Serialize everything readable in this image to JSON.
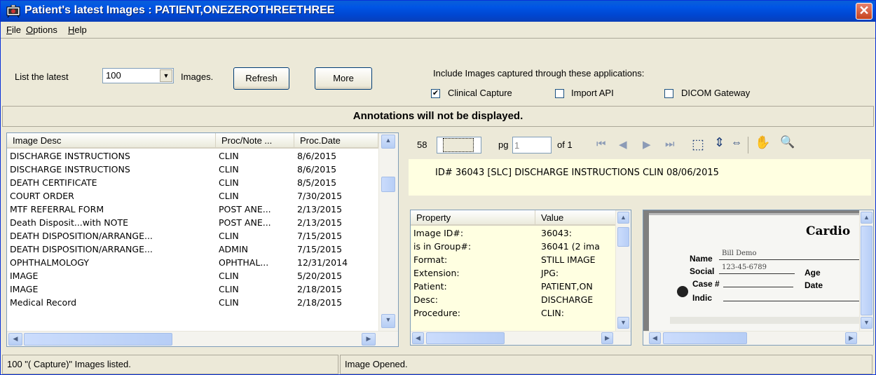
{
  "window": {
    "title": "Patient's latest Images : PATIENT,ONEZEROTHREETHREE",
    "close_symbol": "✕"
  },
  "menu": [
    {
      "label": "File",
      "key": "F"
    },
    {
      "label": "Options",
      "key": "O"
    },
    {
      "label": "Help",
      "key": "H"
    }
  ],
  "toolbar": {
    "list_prefix": "List the latest",
    "count_value": "100",
    "list_suffix": "Images.",
    "refresh_label": "Refresh",
    "more_label": "More",
    "include_label": "Include Images captured through these applications:",
    "sources": [
      {
        "label": "Clinical Capture",
        "checked": true
      },
      {
        "label": "Import API",
        "checked": false
      },
      {
        "label": "DICOM Gateway",
        "checked": false
      }
    ]
  },
  "banner": "Annotations will not be displayed.",
  "image_list": {
    "columns": [
      "Image Desc",
      "Proc/Note ...",
      "Proc.Date"
    ],
    "rows": [
      [
        "DISCHARGE INSTRUCTIONS",
        "CLIN",
        "8/6/2015"
      ],
      [
        "DISCHARGE INSTRUCTIONS",
        "CLIN",
        "8/6/2015"
      ],
      [
        "DEATH CERTIFICATE",
        "CLIN",
        "8/5/2015"
      ],
      [
        "COURT ORDER",
        "CLIN",
        "7/30/2015"
      ],
      [
        "MTF REFERRAL FORM",
        "POST ANE...",
        "2/13/2015"
      ],
      [
        "Death Disposit...with NOTE",
        "POST ANE...",
        "2/13/2015"
      ],
      [
        "DEATH DISPOSITION/ARRANGE...",
        "CLIN",
        "7/15/2015"
      ],
      [
        "DEATH DISPOSITION/ARRANGE...",
        "ADMIN",
        "7/15/2015"
      ],
      [
        "OPHTHALMOLOGY",
        "OPHTHAL...",
        "12/31/2014"
      ],
      [
        "IMAGE",
        "CLIN",
        "5/20/2015"
      ],
      [
        "IMAGE",
        "CLIN",
        "2/18/2015"
      ],
      [
        "Medical Record",
        "CLIN",
        "2/18/2015"
      ]
    ]
  },
  "viewer": {
    "count": "58",
    "pg_label": "pg",
    "pg_value": "1",
    "of_label": "of 1",
    "info": "ID# 36043 [SLC] DISCHARGE INSTRUCTIONS CLIN 08/06/2015"
  },
  "properties": {
    "columns": [
      "Property",
      "Value"
    ],
    "rows": [
      [
        "Image ID#:",
        "36043:"
      ],
      [
        " is in Group#:",
        "36041  (2 ima"
      ],
      [
        "Format:",
        "STILL IMAGE"
      ],
      [
        "Extension:",
        "JPG:"
      ],
      [
        "Patient:",
        "PATIENT,ON"
      ],
      [
        "Desc:",
        "DISCHARGE"
      ],
      [
        "Procedure:",
        "CLIN:"
      ]
    ]
  },
  "preview_doc": {
    "heading": "Cardio",
    "name_label": "Name",
    "name_value": "Bill Demo",
    "social_label": "Social",
    "social_value": "123-45-6789",
    "age_label": "Age",
    "case_label": "Case #",
    "date_label": "Date",
    "indic_label": "Indic"
  },
  "status": {
    "left": "100  \"( Capture)\" Images listed.",
    "right": "Image Opened."
  }
}
